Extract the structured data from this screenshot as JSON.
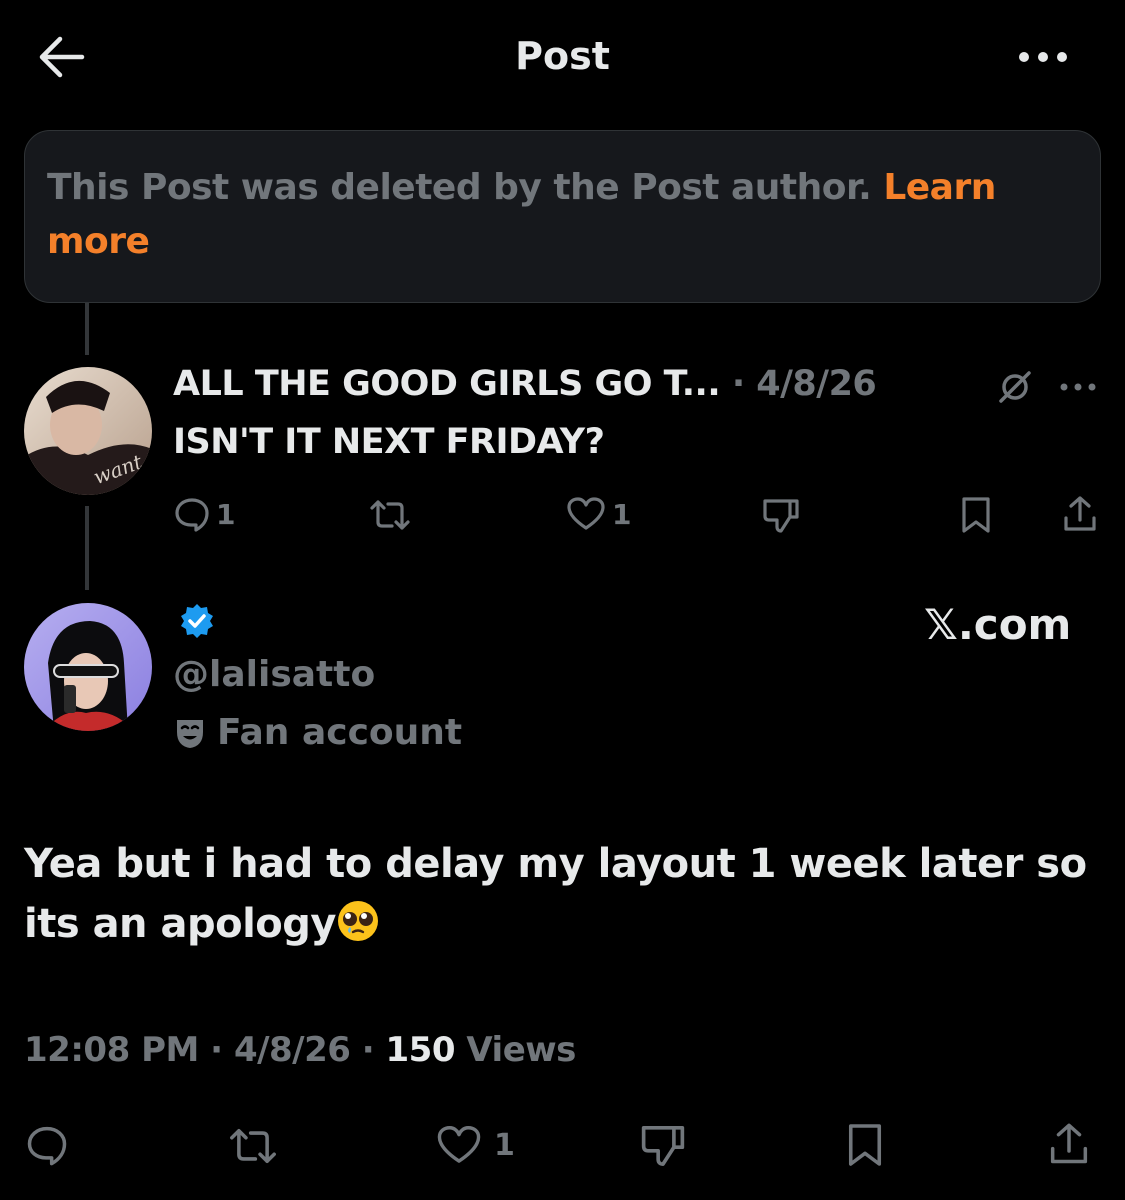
{
  "header": {
    "title": "Post",
    "back_icon": "arrow-left-icon",
    "more_icon": "more-horizontal-icon"
  },
  "notice": {
    "text": "This Post was deleted by the Post author. ",
    "link": "Learn more"
  },
  "reply": {
    "name": "ALL THE GOOD GIRLS GO T...",
    "date": "· 4/8/26",
    "body": "ISN'T IT NEXT FRIDAY?",
    "avatar_text": "want you",
    "actions": {
      "replies": "1",
      "reposts": "",
      "likes": "1"
    }
  },
  "post": {
    "handle": "@lalisatto",
    "label": "Fan account",
    "source": "𝕏.com",
    "text": "Yea but i had to delay my layout 1 week later so its an apology",
    "emoji": "pleading-face-emoji",
    "time": "12:08 PM",
    "date": "4/8/26",
    "views_count": "150",
    "views_label": "Views",
    "actions": {
      "likes": "1"
    }
  },
  "colors": {
    "background": "#000000",
    "muted": "#71767b",
    "text": "#e7e9ea",
    "link": "#f4802a",
    "verified": "#1d9bf0"
  }
}
